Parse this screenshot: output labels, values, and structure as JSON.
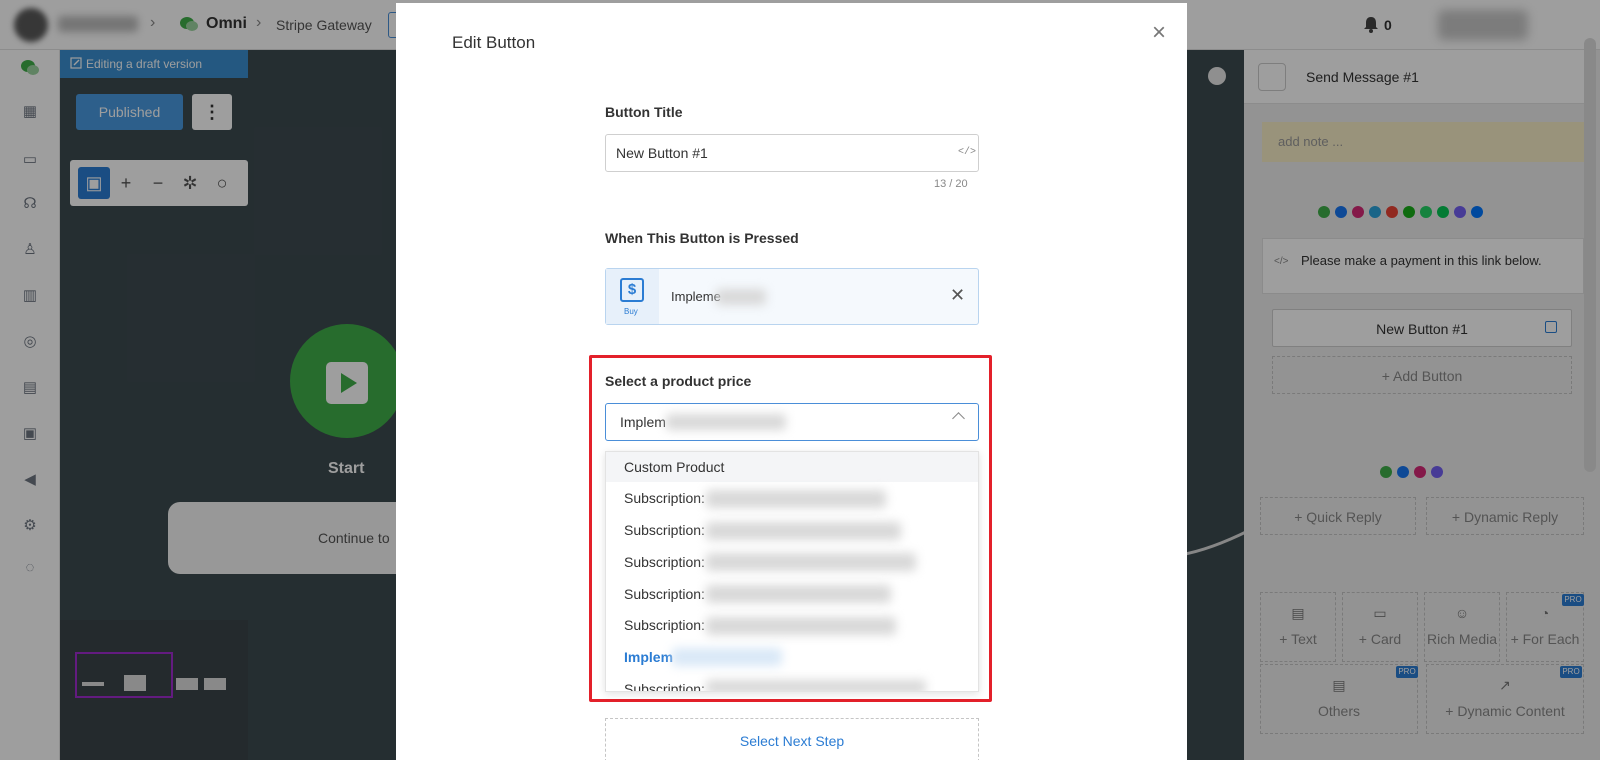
{
  "topbar": {
    "crumb_omni": "Omni",
    "crumb_stripe": "Stripe Gateway",
    "notification_count": "0"
  },
  "canvas": {
    "draft_label": "Editing a draft version",
    "publish_label": "Published",
    "kebab_label": "⋮",
    "start_label": "Start",
    "continue_label": "Continue to"
  },
  "right_panel": {
    "title": "Send Message #1",
    "note_placeholder": "add note ...",
    "message_text": "Please make a payment in this link below.",
    "button_label": "New Button #1",
    "add_button": "+ Add Button",
    "quick_reply": "+ Quick Reply",
    "dynamic_reply": "+ Dynamic Reply",
    "tiles": [
      "+ Text",
      "+ Card",
      "Rich Media",
      "+ For Each",
      "Others",
      "+ Dynamic Content"
    ],
    "pro_badge": "PRO"
  },
  "modal": {
    "title": "Edit Button",
    "close_glyph": "×",
    "button_title_label": "Button Title",
    "button_title_value": "New Button #1",
    "code_glyph": "</>",
    "counter": "13 / 20",
    "pressed_label": "When This Button is Pressed",
    "action_buy_label": "Buy",
    "action_text": "Impleme",
    "action_remove_glyph": "✕",
    "price_label": "Select a product price",
    "price_selected": "Implem",
    "options": [
      "Custom Product",
      "Subscription:",
      "Subscription:",
      "Subscription:",
      "Subscription:",
      "Subscription:",
      "Implem",
      "Subscription:"
    ],
    "next_step": "Select Next Step"
  },
  "colors": {
    "accent": "#2b7cd3",
    "highlight": "#e3202a",
    "start_green": "#3fae49",
    "canvas_bg": "#3d4b50"
  }
}
